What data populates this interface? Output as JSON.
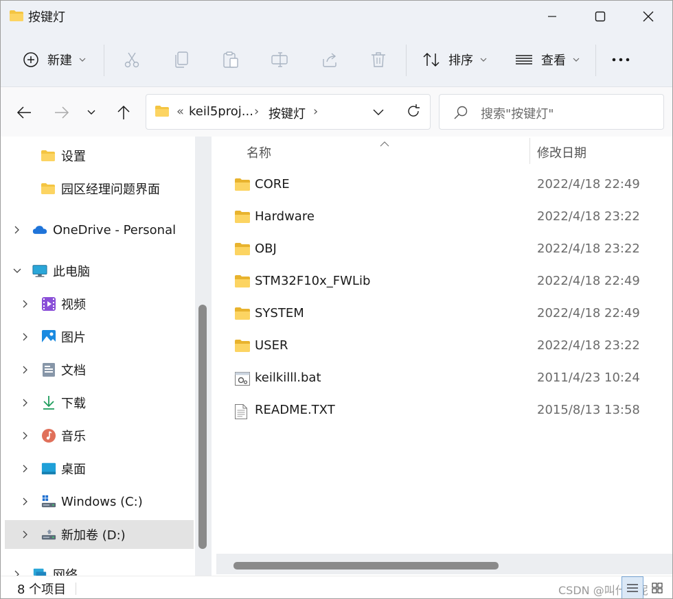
{
  "window": {
    "title": "按键灯"
  },
  "toolbar": {
    "new_label": "新建",
    "sort_label": "排序",
    "view_label": "查看",
    "more_label": "..."
  },
  "address": {
    "overflow": "«",
    "crumbs": [
      "keil5proj...",
      "按键灯"
    ],
    "separator": "›"
  },
  "search": {
    "placeholder": "搜索\"按键灯\""
  },
  "nav": {
    "items": [
      {
        "label": "设置",
        "icon": "folder-icon"
      },
      {
        "label": "园区经理问题界面",
        "icon": "folder-icon"
      },
      {
        "label": "OneDrive - Personal",
        "icon": "cloud-icon"
      },
      {
        "label": "此电脑",
        "icon": "monitor-icon"
      },
      {
        "label": "视频",
        "icon": "video-icon"
      },
      {
        "label": "图片",
        "icon": "picture-icon"
      },
      {
        "label": "文档",
        "icon": "document-icon"
      },
      {
        "label": "下载",
        "icon": "download-icon"
      },
      {
        "label": "音乐",
        "icon": "music-icon"
      },
      {
        "label": "桌面",
        "icon": "desktop-icon"
      },
      {
        "label": "Windows  (C:)",
        "icon": "drive-c-icon"
      },
      {
        "label": "新加卷 (D:)",
        "icon": "drive-d-icon"
      },
      {
        "label": "网络",
        "icon": "network-icon"
      }
    ]
  },
  "columns": {
    "name": "名称",
    "date": "修改日期"
  },
  "files": [
    {
      "name": "CORE",
      "date": "2022/4/18 22:49",
      "type": "folder"
    },
    {
      "name": "Hardware",
      "date": "2022/4/18 23:22",
      "type": "folder"
    },
    {
      "name": "OBJ",
      "date": "2022/4/18 23:22",
      "type": "folder"
    },
    {
      "name": "STM32F10x_FWLib",
      "date": "2022/4/18 22:49",
      "type": "folder"
    },
    {
      "name": "SYSTEM",
      "date": "2022/4/18 22:49",
      "type": "folder"
    },
    {
      "name": "USER",
      "date": "2022/4/18 23:22",
      "type": "folder"
    },
    {
      "name": "keilkilll.bat",
      "date": "2011/4/23 10:24",
      "type": "bat"
    },
    {
      "name": "README.TXT",
      "date": "2015/8/13 13:58",
      "type": "txt"
    }
  ],
  "status": {
    "count": "8 个项目",
    "watermark": "CSDN @叫什么呢"
  },
  "colors": {
    "folder": "#f4c542",
    "accent": "#0067c0",
    "selection": "#e3e3e3"
  }
}
